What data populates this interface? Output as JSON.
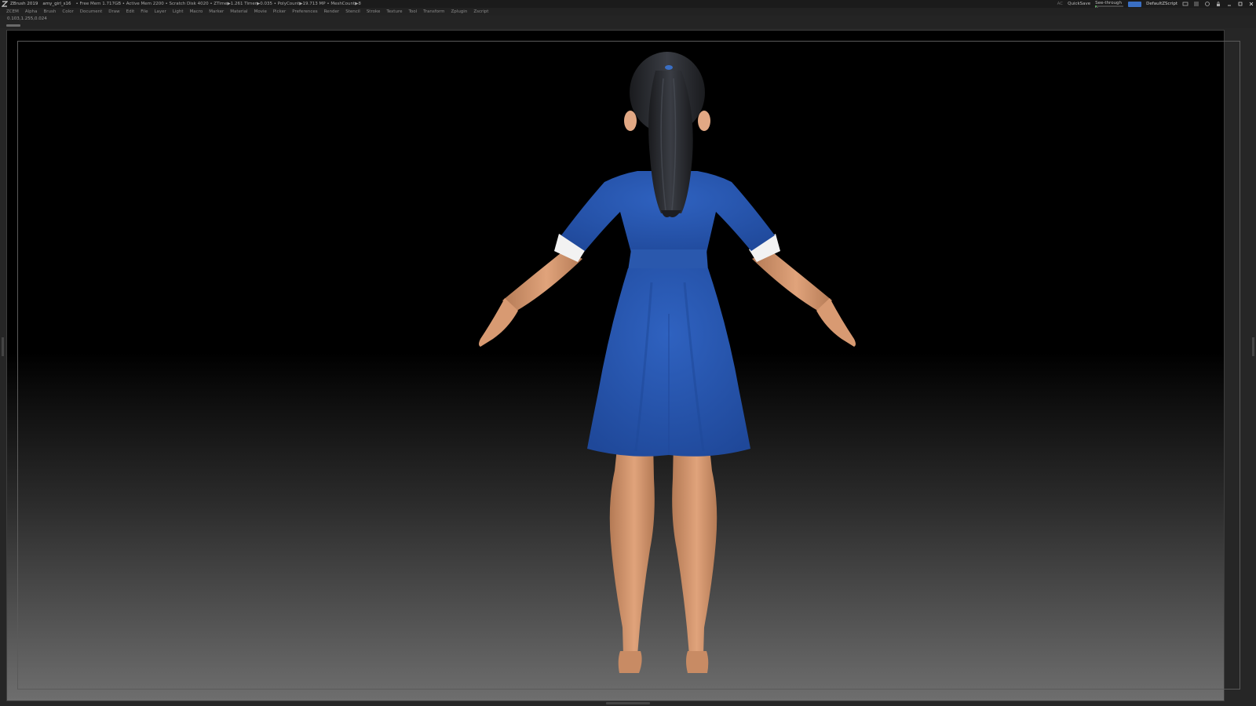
{
  "titlebar": {
    "app_name": "ZBrush 2019",
    "file_name": "amy_girl_s16",
    "stats": "• Free Mem 1.717GB • Active Mem 2200 • Scratch Disk 4020 • ZTime▶1.261 Timer▶0.035 • PolyCount▶19.713 MP • MeshCount▶8",
    "ac_label": "AC",
    "quicksave_label": "QuickSave",
    "see_through_label": "See-through 0",
    "see_through_value": 0.06,
    "default_script_label": "DefaultZScript"
  },
  "menubar": {
    "items": [
      "ZCEM",
      "Alpha",
      "Brush",
      "Color",
      "Document",
      "Draw",
      "Edit",
      "File",
      "Layer",
      "Light",
      "Macro",
      "Marker",
      "Material",
      "Movie",
      "Picker",
      "Preferences",
      "Render",
      "Stencil",
      "Stroke",
      "Texture",
      "Tool",
      "Transform",
      "Zplugin",
      "Zscript"
    ]
  },
  "status": {
    "coords": "0.103,1.255,0.024"
  },
  "colors": {
    "dress": "#2f62c0",
    "dress_shadow": "#1f4899",
    "skin": "#e0a37b",
    "skin_shadow": "#b47a55",
    "hair": "#232529",
    "cuff": "#f2f2f2",
    "accent": "#3a6fc4"
  },
  "icons": [
    "zbrush-logo-icon",
    "menus-icon",
    "lightbox-icon",
    "layout-icon",
    "palette-icon",
    "lock-icon",
    "minimize-icon",
    "maximize-icon",
    "close-icon"
  ]
}
